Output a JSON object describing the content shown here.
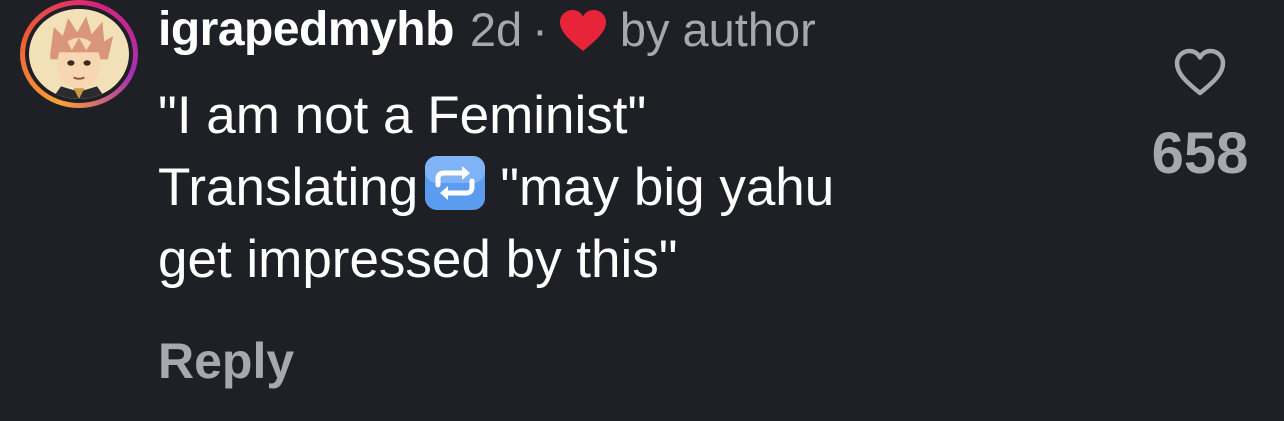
{
  "comment": {
    "username": "igrapedmyhb",
    "age": "2d",
    "separator": "·",
    "liked_by_label": "by author",
    "text_lines": [
      "\"I am not a Feminist\"",
      "Translating",
      "\"may big yahu",
      "get impressed by this\""
    ],
    "emoji": "repeat-button-icon",
    "reply_label": "Reply",
    "like_count": "658"
  },
  "colors": {
    "background": "#1f2025",
    "text": "#ffffff",
    "muted": "#a7a8ad",
    "heart": "#e8243a",
    "emoji_blue": "#5b9cf0"
  }
}
